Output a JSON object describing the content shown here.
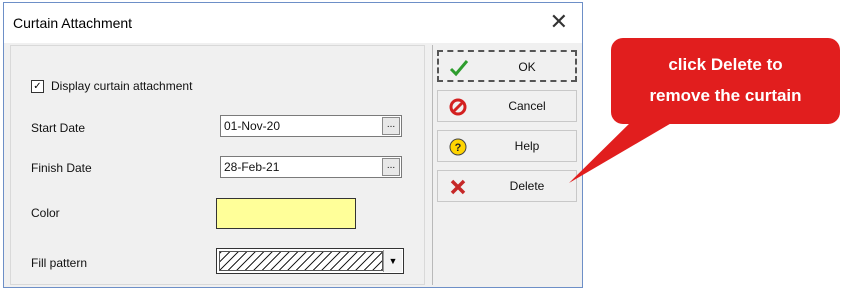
{
  "window": {
    "title": "Curtain Attachment",
    "close_glyph": "✕"
  },
  "form": {
    "display_checkbox_label": "Display curtain attachment",
    "display_checked": true,
    "start_date_label": "Start Date",
    "start_date_value": "01-Nov-20",
    "finish_date_label": "Finish Date",
    "finish_date_value": "28-Feb-21",
    "date_button_glyph": "...",
    "color_label": "Color",
    "color_value": "#ffff99",
    "fill_pattern_label": "Fill pattern",
    "fill_pattern_dropdown_glyph": "▼"
  },
  "buttons": {
    "ok_label": "OK",
    "cancel_label": "Cancel",
    "help_label": "Help",
    "delete_label": "Delete"
  },
  "callout": {
    "line1": "click Delete to",
    "line2": "remove the curtain",
    "color": "#e11e1e"
  },
  "icons": {
    "ok": "check-icon",
    "cancel": "no-entry-icon",
    "help": "help-icon",
    "delete": "x-icon"
  }
}
